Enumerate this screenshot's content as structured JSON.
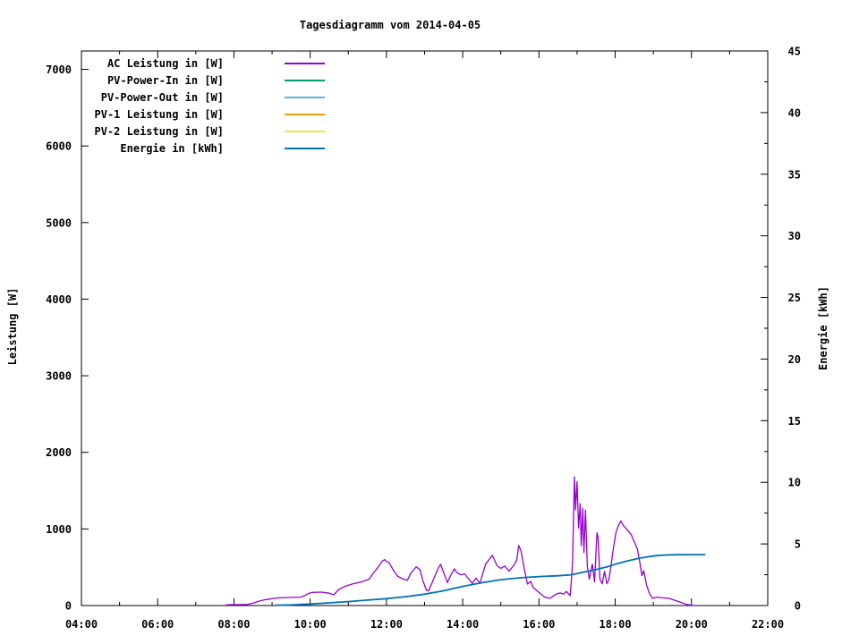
{
  "chart": {
    "title": "Tagesdiagramm vom 2014-04-05",
    "x_axis": {
      "ticks": [
        {
          "value": 4,
          "label": "04:00"
        },
        {
          "value": 6,
          "label": "06:00"
        },
        {
          "value": 8,
          "label": "08:00"
        },
        {
          "value": 10,
          "label": "10:00"
        },
        {
          "value": 12,
          "label": "12:00"
        },
        {
          "value": 14,
          "label": "14:00"
        },
        {
          "value": 16,
          "label": "16:00"
        },
        {
          "value": 18,
          "label": "18:00"
        },
        {
          "value": 20,
          "label": "20:00"
        },
        {
          "value": 22,
          "label": "22:00"
        }
      ]
    },
    "y_left": {
      "label": "Leistung [W]",
      "ticks": [
        {
          "value": 0,
          "label": "0"
        },
        {
          "value": 1000,
          "label": "1000"
        },
        {
          "value": 2000,
          "label": "2000"
        },
        {
          "value": 3000,
          "label": "3000"
        },
        {
          "value": 4000,
          "label": "4000"
        },
        {
          "value": 5000,
          "label": "5000"
        },
        {
          "value": 6000,
          "label": "6000"
        },
        {
          "value": 7000,
          "label": "7000"
        }
      ]
    },
    "y_right": {
      "label": "Energie [kWh]",
      "ticks": [
        {
          "value": 0,
          "label": "0"
        },
        {
          "value": 5,
          "label": "5"
        },
        {
          "value": 10,
          "label": "10"
        },
        {
          "value": 15,
          "label": "15"
        },
        {
          "value": 20,
          "label": "20"
        },
        {
          "value": 25,
          "label": "25"
        },
        {
          "value": 30,
          "label": "30"
        },
        {
          "value": 35,
          "label": "35"
        },
        {
          "value": 40,
          "label": "40"
        },
        {
          "value": 45,
          "label": "45"
        }
      ]
    },
    "legend": [
      {
        "label": "AC Leistung in [W]",
        "color": "#9400D3"
      },
      {
        "label": "PV-Power-In in [W]",
        "color": "#009E73"
      },
      {
        "label": "PV-Power-Out in [W]",
        "color": "#56B4E9"
      },
      {
        "label": "PV-1 Leistung in [W]",
        "color": "#E69F00"
      },
      {
        "label": "PV-2 Leistung in [W]",
        "color": "#F0E442"
      },
      {
        "label": "Energie in [kWh]",
        "color": "#0072B2"
      }
    ]
  },
  "chart_data": {
    "type": "line",
    "title": "Tagesdiagramm vom 2014-04-05",
    "xlabel": "",
    "x_unit": "hour of day",
    "x_range": [
      4,
      22
    ],
    "x_major_step_hours": 2,
    "x_minor_step_hours": 1,
    "y_left_label": "Leistung [W]",
    "y_left_range": [
      0,
      7240
    ],
    "y_right_label": "Energie [kWh]",
    "y_right_range": [
      0,
      45
    ],
    "y_right_minor_step": 2.5,
    "grid": false,
    "legend_position": "top-left-inside",
    "series": [
      {
        "name": "AC Leistung in [W]",
        "axis": "left",
        "color": "#9400D3",
        "points": [
          [
            7.8,
            8
          ],
          [
            7.9,
            12
          ],
          [
            8.1,
            12
          ],
          [
            8.35,
            14
          ],
          [
            8.5,
            30
          ],
          [
            8.65,
            55
          ],
          [
            8.8,
            75
          ],
          [
            8.95,
            85
          ],
          [
            9.05,
            95
          ],
          [
            9.2,
            100
          ],
          [
            9.45,
            105
          ],
          [
            9.75,
            110
          ],
          [
            9.85,
            130
          ],
          [
            9.95,
            155
          ],
          [
            10.05,
            172
          ],
          [
            10.3,
            175
          ],
          [
            10.5,
            160
          ],
          [
            10.62,
            140
          ],
          [
            10.75,
            210
          ],
          [
            10.9,
            248
          ],
          [
            11.1,
            280
          ],
          [
            11.35,
            310
          ],
          [
            11.55,
            345
          ],
          [
            11.65,
            420
          ],
          [
            11.78,
            500
          ],
          [
            11.88,
            575
          ],
          [
            11.95,
            600
          ],
          [
            12.0,
            575
          ],
          [
            12.07,
            560
          ],
          [
            12.18,
            460
          ],
          [
            12.3,
            380
          ],
          [
            12.45,
            345
          ],
          [
            12.55,
            330
          ],
          [
            12.65,
            430
          ],
          [
            12.78,
            505
          ],
          [
            12.88,
            470
          ],
          [
            12.95,
            330
          ],
          [
            13.05,
            200
          ],
          [
            13.1,
            190
          ],
          [
            13.2,
            300
          ],
          [
            13.35,
            480
          ],
          [
            13.42,
            540
          ],
          [
            13.5,
            430
          ],
          [
            13.6,
            300
          ],
          [
            13.68,
            390
          ],
          [
            13.78,
            480
          ],
          [
            13.85,
            430
          ],
          [
            13.95,
            400
          ],
          [
            14.05,
            415
          ],
          [
            14.15,
            350
          ],
          [
            14.25,
            290
          ],
          [
            14.35,
            360
          ],
          [
            14.45,
            290
          ],
          [
            14.6,
            540
          ],
          [
            14.78,
            655
          ],
          [
            14.9,
            520
          ],
          [
            15.0,
            485
          ],
          [
            15.1,
            515
          ],
          [
            15.22,
            450
          ],
          [
            15.35,
            530
          ],
          [
            15.42,
            600
          ],
          [
            15.47,
            783
          ],
          [
            15.53,
            715
          ],
          [
            15.62,
            470
          ],
          [
            15.7,
            280
          ],
          [
            15.78,
            315
          ],
          [
            15.85,
            235
          ],
          [
            16.0,
            170
          ],
          [
            16.15,
            110
          ],
          [
            16.3,
            95
          ],
          [
            16.45,
            150
          ],
          [
            16.55,
            165
          ],
          [
            16.65,
            150
          ],
          [
            16.72,
            185
          ],
          [
            16.82,
            130
          ],
          [
            16.88,
            540
          ],
          [
            16.93,
            1680
          ],
          [
            16.96,
            1250
          ],
          [
            17.0,
            1615
          ],
          [
            17.04,
            1010
          ],
          [
            17.08,
            1330
          ],
          [
            17.11,
            780
          ],
          [
            17.15,
            1265
          ],
          [
            17.18,
            690
          ],
          [
            17.22,
            1245
          ],
          [
            17.27,
            510
          ],
          [
            17.32,
            345
          ],
          [
            17.4,
            540
          ],
          [
            17.46,
            310
          ],
          [
            17.52,
            950
          ],
          [
            17.55,
            890
          ],
          [
            17.6,
            345
          ],
          [
            17.66,
            285
          ],
          [
            17.72,
            445
          ],
          [
            17.78,
            285
          ],
          [
            17.83,
            330
          ],
          [
            17.88,
            480
          ],
          [
            17.95,
            740
          ],
          [
            18.02,
            950
          ],
          [
            18.08,
            1040
          ],
          [
            18.15,
            1105
          ],
          [
            18.22,
            1040
          ],
          [
            18.32,
            985
          ],
          [
            18.42,
            925
          ],
          [
            18.5,
            830
          ],
          [
            18.58,
            740
          ],
          [
            18.65,
            545
          ],
          [
            18.7,
            390
          ],
          [
            18.75,
            455
          ],
          [
            18.82,
            270
          ],
          [
            18.9,
            155
          ],
          [
            18.98,
            95
          ],
          [
            19.1,
            110
          ],
          [
            19.25,
            100
          ],
          [
            19.4,
            95
          ],
          [
            19.55,
            70
          ],
          [
            19.7,
            45
          ],
          [
            19.85,
            18
          ],
          [
            20.0,
            5
          ],
          [
            20.1,
            0
          ]
        ]
      },
      {
        "name": "Energie in [kWh]",
        "axis": "right",
        "color": "#0072B2",
        "points": [
          [
            9.1,
            0.02
          ],
          [
            9.5,
            0.05
          ],
          [
            10.0,
            0.12
          ],
          [
            10.5,
            0.22
          ],
          [
            11.0,
            0.32
          ],
          [
            11.5,
            0.44
          ],
          [
            12.0,
            0.56
          ],
          [
            12.5,
            0.72
          ],
          [
            13.0,
            0.92
          ],
          [
            13.5,
            1.2
          ],
          [
            14.0,
            1.55
          ],
          [
            14.5,
            1.85
          ],
          [
            15.0,
            2.1
          ],
          [
            15.5,
            2.25
          ],
          [
            16.0,
            2.35
          ],
          [
            16.5,
            2.42
          ],
          [
            16.85,
            2.5
          ],
          [
            17.0,
            2.6
          ],
          [
            17.2,
            2.73
          ],
          [
            17.5,
            2.92
          ],
          [
            17.8,
            3.15
          ],
          [
            18.0,
            3.35
          ],
          [
            18.3,
            3.6
          ],
          [
            18.6,
            3.82
          ],
          [
            18.9,
            3.98
          ],
          [
            19.1,
            4.05
          ],
          [
            19.3,
            4.1
          ],
          [
            19.6,
            4.12
          ],
          [
            20.0,
            4.13
          ],
          [
            20.35,
            4.13
          ]
        ]
      }
    ]
  }
}
